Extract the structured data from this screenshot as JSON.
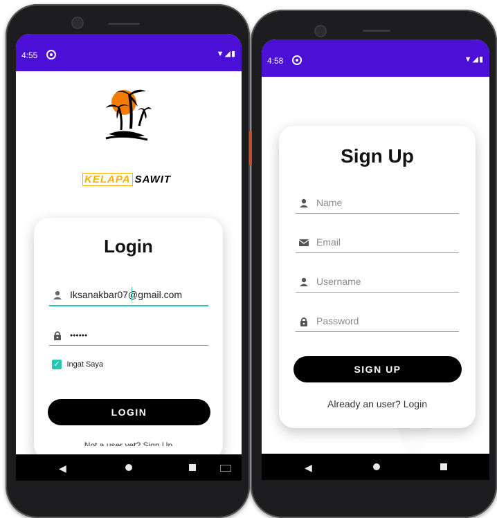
{
  "left_phone": {
    "status": {
      "time": "4:55",
      "icons": "▼◢▮"
    },
    "brand": {
      "left": "KELAPA",
      "right": "SAWIT"
    },
    "login": {
      "title": "Login",
      "email_value": "Iksanakbar07@gmail.com",
      "password_value": "••••••",
      "remember_label": "Ingat Saya",
      "remember_checked": true,
      "button_label": "LOGIN",
      "signup_link": "Not a user yet? Sign Up"
    }
  },
  "right_phone": {
    "status": {
      "time": "4:58",
      "icons": "▼◢▮"
    },
    "signup": {
      "title": "Sign Up",
      "name_placeholder": "Name",
      "email_placeholder": "Email",
      "username_placeholder": "Username",
      "password_placeholder": "Password",
      "button_label": "SIGN UP",
      "login_link": "Already an user? Login"
    }
  },
  "colors": {
    "status_bar": "#4b0fd6",
    "accent": "#26c6b0",
    "button": "#000000",
    "sun": "#f57c00"
  },
  "nav_icons": [
    "back-icon",
    "home-icon",
    "recents-icon",
    "keyboard-icon"
  ]
}
